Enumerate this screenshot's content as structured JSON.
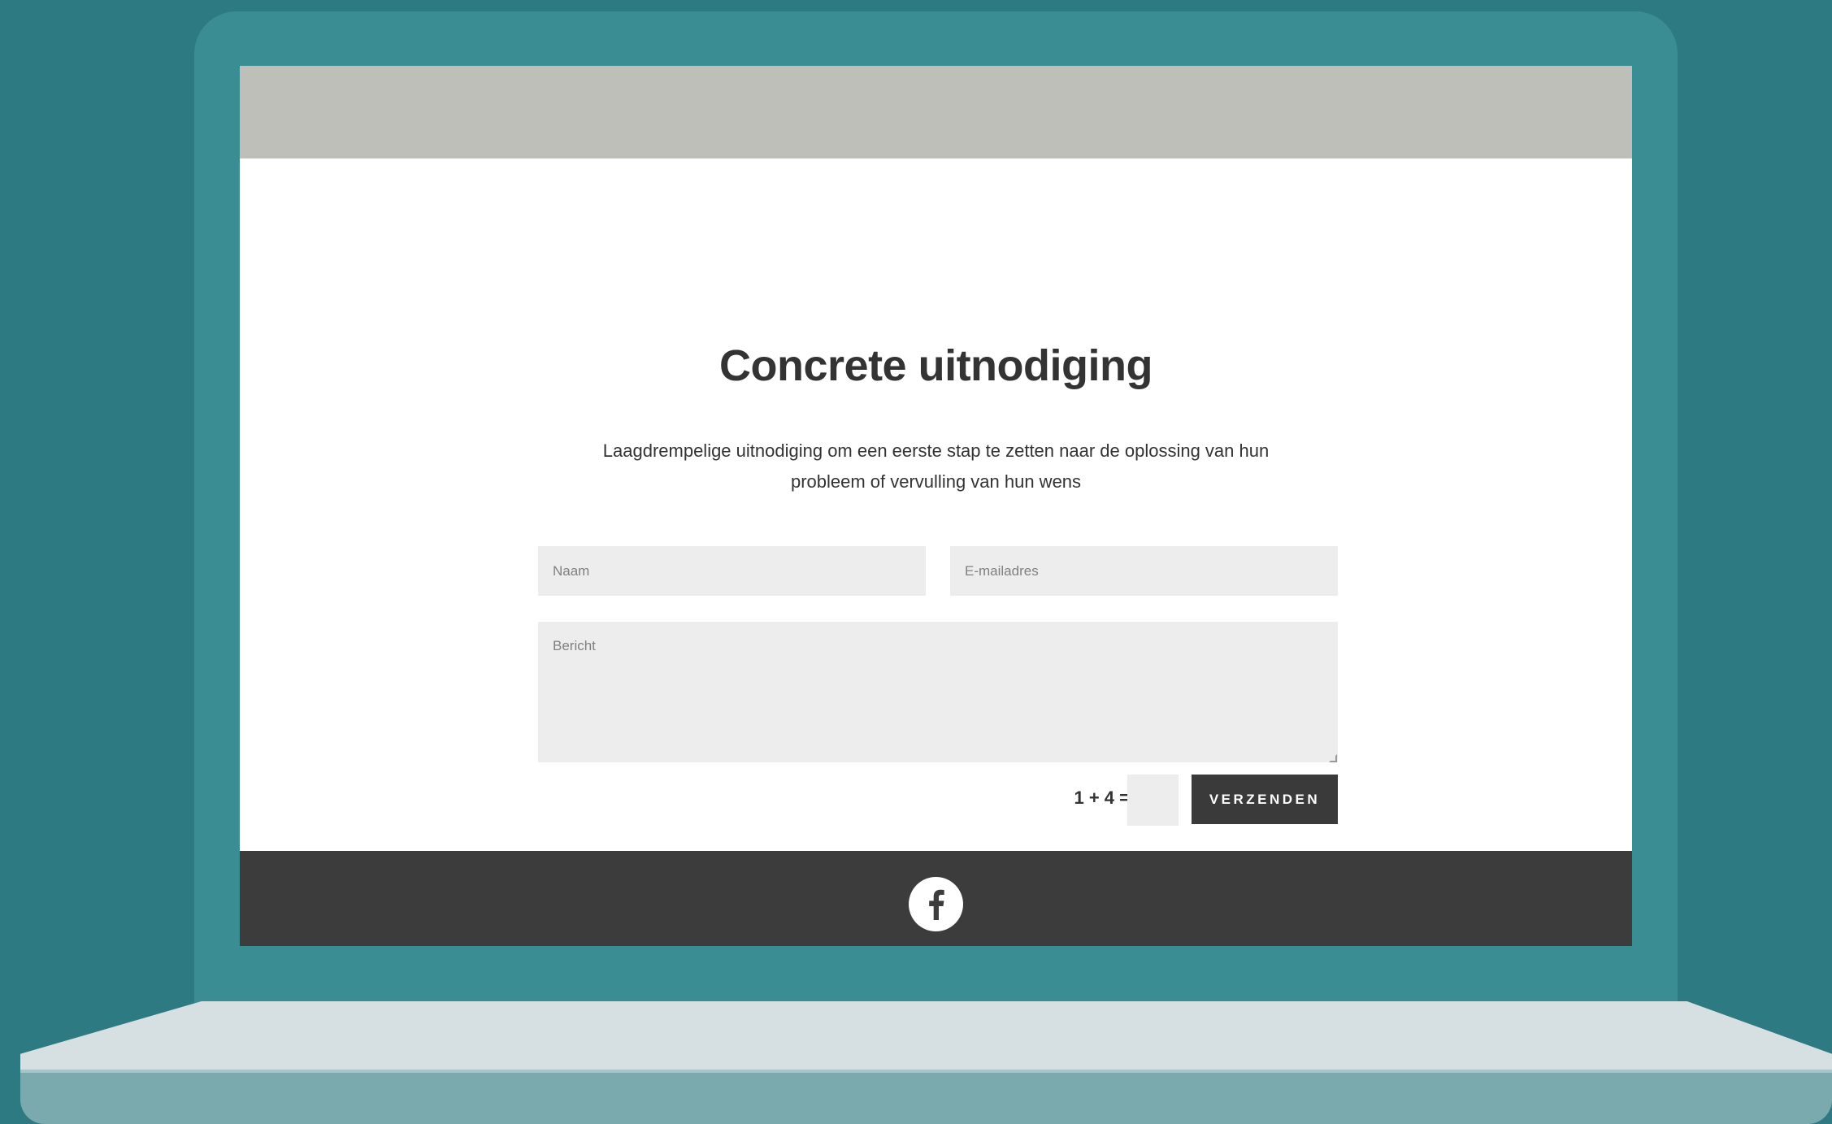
{
  "page": {
    "title": "Concrete uitnodiging",
    "subtitle": "Laagdrempelige uitnodiging om een eerste stap te zetten naar de oplossing van hun probleem of vervulling van hun wens"
  },
  "form": {
    "name_placeholder": "Naam",
    "email_placeholder": "E-mailadres",
    "message_placeholder": "Bericht",
    "captcha_question": "1 + 4 =",
    "captcha_value": "",
    "submit_label": "VERZENDEN"
  },
  "footer": {
    "social_icons": [
      "facebook-icon"
    ]
  },
  "colors": {
    "background": "#2e7a82",
    "laptop_frame": "#3a8d93",
    "header_bar": "#bfbfba",
    "button": "#3a3a3a",
    "footer": "#3c3c3c",
    "field": "#ededed"
  }
}
